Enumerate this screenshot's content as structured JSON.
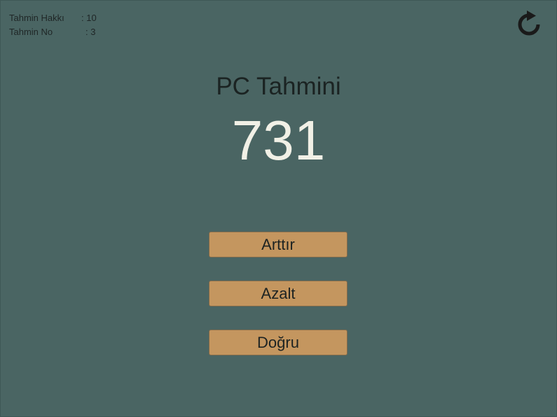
{
  "stats": {
    "rights_label": "Tahmin Hakkı",
    "rights_value": ": 10",
    "guess_no_label": "Tahmin No",
    "guess_no_value": ": 3"
  },
  "reset": {
    "icon": "restart-icon"
  },
  "main": {
    "title": "PC Tahmini",
    "guess": "731"
  },
  "buttons": {
    "increase": "Arttır",
    "decrease": "Azalt",
    "correct": "Doğru"
  },
  "colors": {
    "background": "#4a6563",
    "button": "#c4965f",
    "guess_text": "#f1f0e6",
    "dark_text": "#1b2322"
  }
}
